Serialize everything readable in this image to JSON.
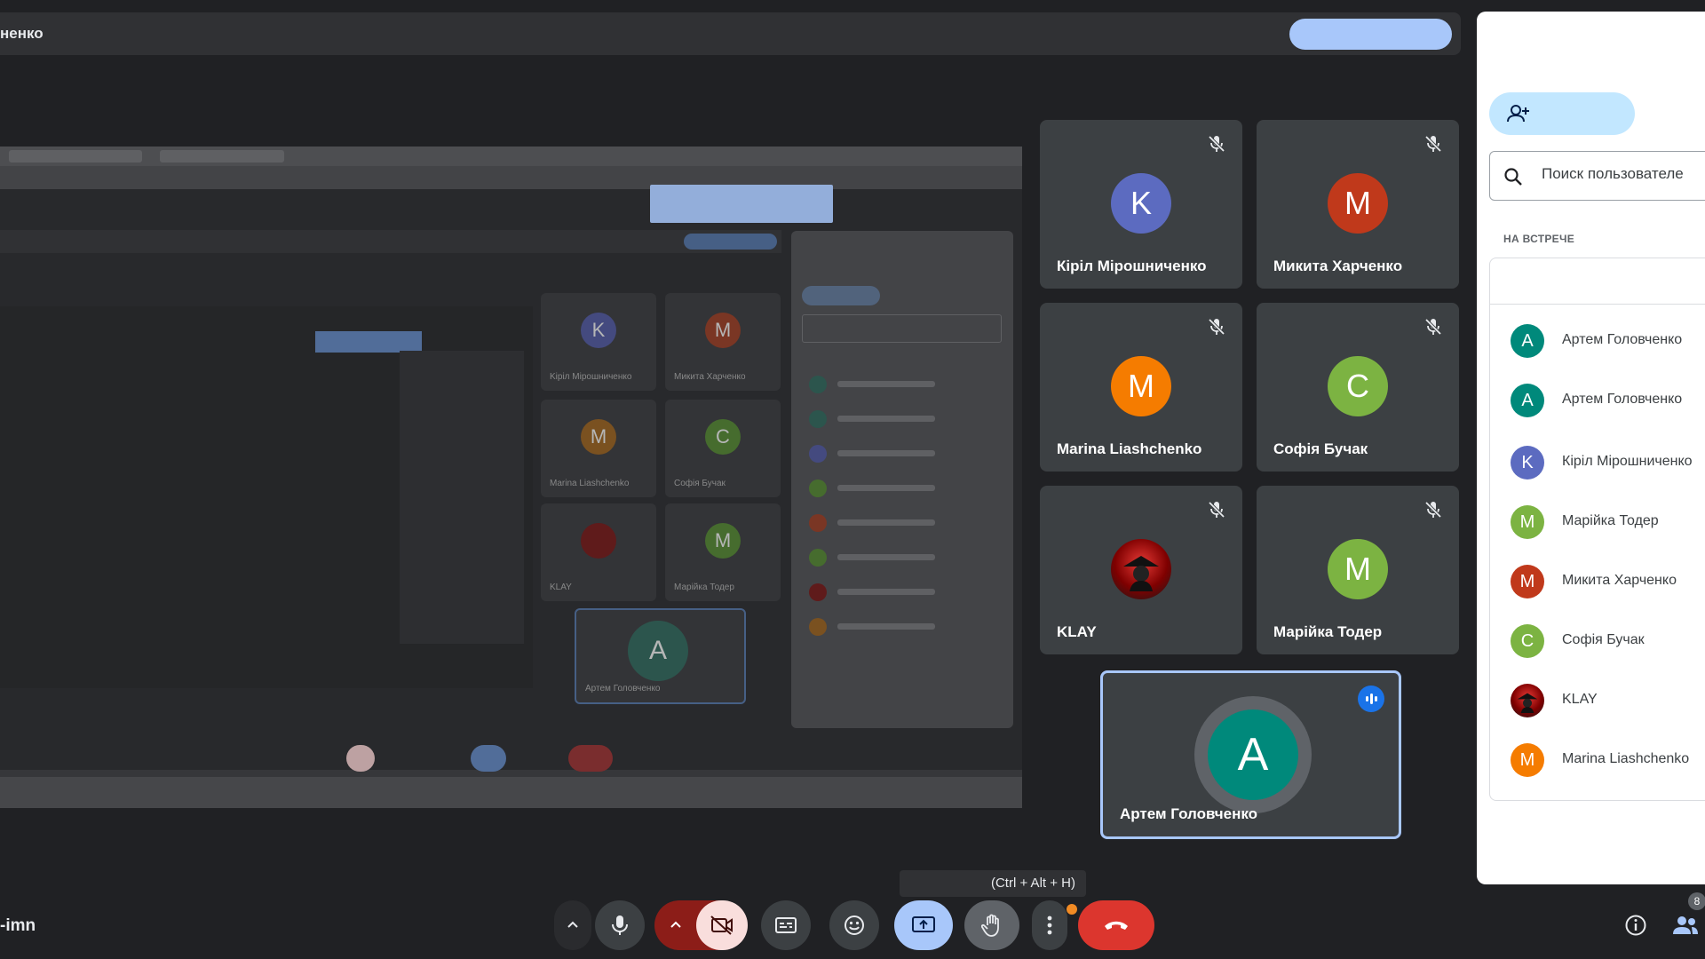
{
  "topbar": {
    "presenter": "ненко"
  },
  "shared_screen": {
    "tiles": [
      {
        "initial": "K",
        "name": "Kipiл Mipoшниченко",
        "color": "#4b5290"
      },
      {
        "initial": "M",
        "name": "Микита Харченко",
        "color": "#8a3a25"
      },
      {
        "initial": "M",
        "name": "Marina Liashchenko",
        "color": "#8a5a20"
      },
      {
        "initial": "C",
        "name": "Софія Бучак",
        "color": "#4d7a30"
      },
      {
        "initial": "",
        "name": "KLAY",
        "color": "#6a1a1a"
      },
      {
        "initial": "M",
        "name": "Марійка Тодер",
        "color": "#4d7a30"
      }
    ]
  },
  "tiles": [
    {
      "initial": "K",
      "name": "Кіріл Мірошниченко",
      "color": "#5c6bc0"
    },
    {
      "initial": "M",
      "name": "Микита Харченко",
      "color": "#c0391b"
    },
    {
      "initial": "M",
      "name": "Marina Liashchenko",
      "color": "#f57c00"
    },
    {
      "initial": "C",
      "name": "Софія Бучак",
      "color": "#7cb342"
    },
    {
      "initial": "",
      "name": "KLAY",
      "color": "#b71c1c"
    },
    {
      "initial": "M",
      "name": "Марійка Тодер",
      "color": "#7cb342"
    }
  ],
  "active_tile": {
    "initial": "A",
    "name": "Артем Головченко",
    "color": "#00897b"
  },
  "panel": {
    "search_placeholder": "Поиск пользователе",
    "section_label": "НА ВСТРЕЧЕ",
    "participants": [
      {
        "initial": "A",
        "name": "Артем Головченко",
        "color": "#00897b"
      },
      {
        "initial": "A",
        "name": "Артем Головченко",
        "color": "#00897b"
      },
      {
        "initial": "K",
        "name": "Кіріл Мірошниченко",
        "color": "#5c6bc0"
      },
      {
        "initial": "M",
        "name": "Марійка Тодер",
        "color": "#7cb342"
      },
      {
        "initial": "M",
        "name": "Микита Харченко",
        "color": "#c0391b"
      },
      {
        "initial": "C",
        "name": "Софія Бучак",
        "color": "#7cb342"
      },
      {
        "initial": "",
        "name": "KLAY",
        "color": "#b71c1c"
      },
      {
        "initial": "M",
        "name": "Marina Liashchenko",
        "color": "#f57c00"
      }
    ]
  },
  "bottom": {
    "meeting_code": "-imn",
    "tooltip": "(Ctrl + Alt + H)",
    "participant_count": "8"
  }
}
